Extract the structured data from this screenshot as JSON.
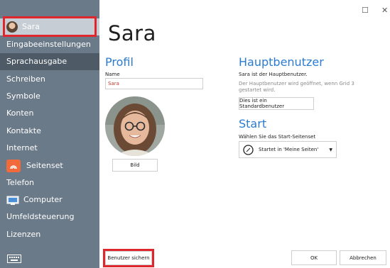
{
  "window": {
    "maximize_glyph": "☐",
    "close_glyph": "✕"
  },
  "sidebar": {
    "user": "Sara",
    "items": [
      {
        "label": "Eingabeeinstellungen"
      },
      {
        "label": "Sprachausgabe"
      },
      {
        "label": "Schreiben"
      },
      {
        "label": "Symbole"
      },
      {
        "label": "Konten"
      },
      {
        "label": "Kontakte"
      },
      {
        "label": "Internet"
      },
      {
        "label": "Seitenset"
      },
      {
        "label": "Telefon"
      },
      {
        "label": "Computer"
      },
      {
        "label": "Umfeldsteuerung"
      },
      {
        "label": "Lizenzen"
      }
    ]
  },
  "main": {
    "title": "Sara",
    "profile": {
      "heading": "Profil",
      "name_label": "Name",
      "name_value": "Sara",
      "picture_button": "Bild"
    },
    "main_user": {
      "heading": "Hauptbenutzer",
      "status": "Sara ist der Hauptbenutzer.",
      "info": "Der Hauptbenutzer wird geöffnet, wenn Grid 3 gestartet wird.",
      "button": "Dies ist ein Standardbenutzer"
    },
    "start": {
      "heading": "Start",
      "label": "Wählen Sie das Start-Seitenset",
      "dropdown_value": "Startet in 'Meine Seiten'"
    }
  },
  "footer": {
    "save_button": "Benutzer sichern",
    "ok_button": "OK",
    "cancel_button": "Abbrechen"
  },
  "colors": {
    "sidebar": "#6b7a89",
    "accent_blue": "#2b7bd0",
    "highlight_red": "#e0262d",
    "seitenset_orange": "#f06a3c"
  }
}
